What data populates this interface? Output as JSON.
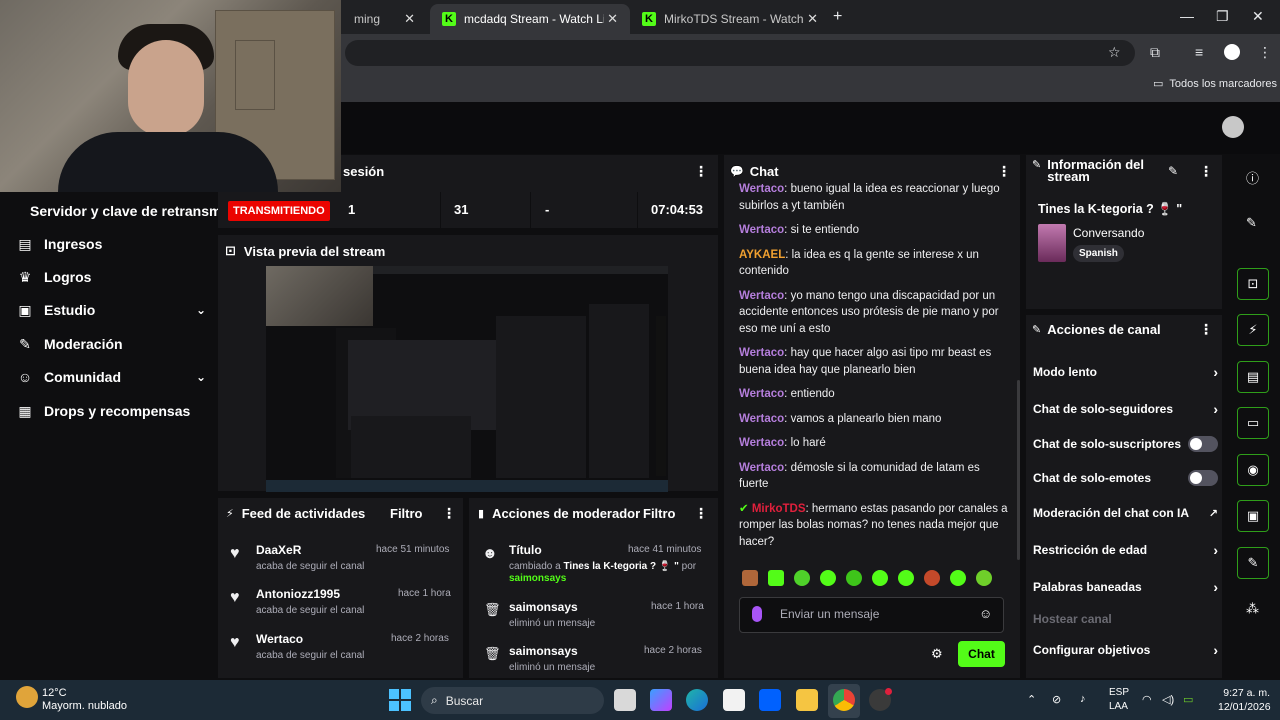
{
  "browser": {
    "tabs": [
      {
        "label": "ming",
        "active": false
      },
      {
        "label": "mcdadq Stream - Watch Live o",
        "active": true
      },
      {
        "label": "MirkoTDS Stream - Watch Live",
        "active": false
      }
    ],
    "new_tab": "+",
    "bookmarks_label": "Todos los marcadores"
  },
  "sidebar": {
    "stream_key_label": "Servidor y clave de retransm",
    "items": [
      {
        "label": "Ingresos",
        "icon": "money-icon"
      },
      {
        "label": "Logros",
        "icon": "trophy-icon"
      },
      {
        "label": "Estudio",
        "icon": "studio-icon",
        "expandable": true
      },
      {
        "label": "Moderación",
        "icon": "wrench-icon"
      },
      {
        "label": "Comunidad",
        "icon": "community-icon",
        "expandable": true
      },
      {
        "label": "Drops y recompensas",
        "icon": "drops-icon"
      }
    ]
  },
  "session": {
    "title": "sesión",
    "status": "TRANSMITIENDO",
    "stats": [
      "1",
      "31",
      "-",
      "07:04:53"
    ]
  },
  "preview": {
    "title": "Vista previa del stream"
  },
  "feed": {
    "title": "Feed de actividades",
    "filter": "Filtro",
    "items": [
      {
        "name": "DaaXeR",
        "sub": "acaba de seguir el canal",
        "time": "hace 51 minutos"
      },
      {
        "name": "Antoniozz1995",
        "sub": "acaba de seguir el canal",
        "time": "hace 1 hora"
      },
      {
        "name": "Wertaco",
        "sub": "acaba de seguir el canal",
        "time": "hace 2 horas"
      }
    ]
  },
  "modactions": {
    "title": "Acciones de moderador",
    "filter": "Filtro",
    "items": [
      {
        "name": "Título",
        "time": "hace 41 minutos",
        "line1": "cambiado a ",
        "bold": "Tines la K-tegoria ? 🍷 \"",
        "line1b": " por",
        "line2": "saimonsays"
      },
      {
        "name": "saimonsays",
        "time": "hace 1 hora",
        "sub": "eliminó un mensaje"
      },
      {
        "name": "saimonsays",
        "time": "hace 2 horas",
        "sub": "eliminó un mensaje"
      }
    ]
  },
  "chat": {
    "title": "Chat",
    "messages": [
      {
        "user": "Wertaco",
        "color": "#b57edc",
        "text": "bueno igual la idea es reaccionar y luego subirlos a yt también"
      },
      {
        "user": "Wertaco",
        "color": "#b57edc",
        "text": "si te entiendo"
      },
      {
        "user": "AYKAEL",
        "color": "#f0a030",
        "text": "la idea es q la gente se interese x un contenido"
      },
      {
        "user": "Wertaco",
        "color": "#b57edc",
        "text": "yo mano tengo una discapacidad por un accidente entonces uso prótesis de pie mano y por eso me uní a esto"
      },
      {
        "user": "Wertaco",
        "color": "#b57edc",
        "text": "hay que hacer algo asi tipo mr beast es buena idea hay que planearlo bien"
      },
      {
        "user": "Wertaco",
        "color": "#b57edc",
        "text": "entiendo"
      },
      {
        "user": "Wertaco",
        "color": "#b57edc",
        "text": "vamos a planearlo bien mano"
      },
      {
        "user": "Wertaco",
        "color": "#b57edc",
        "text": "lo haré"
      },
      {
        "user": "Wertaco",
        "color": "#b57edc",
        "text": "démosle si la comunidad de latam es fuerte"
      },
      {
        "user": "MirkoTDS",
        "color": "#e0203c",
        "text": "hermano estas pasando por canales a romper las bolas nomas? no tenes nada mejor que hacer?"
      }
    ],
    "input_placeholder": "Enviar un mensaje",
    "send_label": "Chat"
  },
  "info": {
    "title": "Información del stream",
    "stream_title": "Tines la K-tegoria ? 🍷 \"",
    "category": "Conversando",
    "language": "Spanish"
  },
  "actions": {
    "title": "Acciones de canal",
    "items": [
      {
        "label": "Modo lento",
        "kind": "arrow"
      },
      {
        "label": "Chat de solo-seguidores",
        "kind": "arrow"
      },
      {
        "label": "Chat de solo-suscriptores",
        "kind": "toggle"
      },
      {
        "label": "Chat de solo-emotes",
        "kind": "toggle"
      },
      {
        "label": "Moderación del chat con IA",
        "kind": "external"
      },
      {
        "label": "Restricción de edad",
        "kind": "arrow"
      },
      {
        "label": "Palabras baneadas",
        "kind": "arrow"
      },
      {
        "label": "Hostear canal",
        "kind": "disabled"
      },
      {
        "label": "Configurar objetivos",
        "kind": "arrow"
      }
    ]
  },
  "taskbar": {
    "weather_temp": "12°C",
    "weather_desc": "Mayorm. nublado",
    "search": "Buscar",
    "lang1": "ESP",
    "lang2": "LAA",
    "time": "9:27 a. m.",
    "date": "12/01/2026"
  },
  "colors": {
    "accent": "#53fc18",
    "live": "#eb0400",
    "panel": "#18181b"
  }
}
